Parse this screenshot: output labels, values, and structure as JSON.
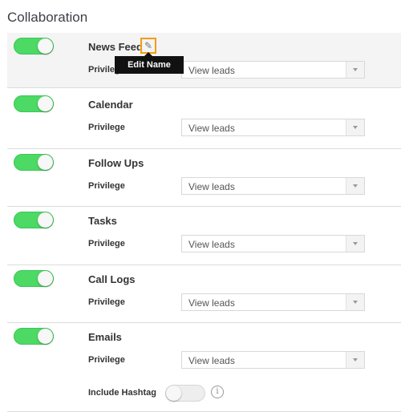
{
  "page": {
    "title": "Collaboration"
  },
  "edit_tooltip": "Edit Name",
  "privilege_label": "Privilege",
  "sections": [
    {
      "name": "News Feed",
      "enabled": true,
      "privilege": "View leads"
    },
    {
      "name": "Calendar",
      "enabled": true,
      "privilege": "View leads"
    },
    {
      "name": "Follow Ups",
      "enabled": true,
      "privilege": "View leads"
    },
    {
      "name": "Tasks",
      "enabled": true,
      "privilege": "View leads"
    },
    {
      "name": "Call Logs",
      "enabled": true,
      "privilege": "View leads"
    },
    {
      "name": "Emails",
      "enabled": true,
      "privilege": "View leads"
    }
  ],
  "include_hashtag": {
    "label": "Include Hashtag",
    "enabled": false,
    "info_icon": "i"
  },
  "colors": {
    "toggle_on": "#4cd964",
    "edit_highlight": "#f39c12",
    "tooltip_bg": "#111111"
  }
}
